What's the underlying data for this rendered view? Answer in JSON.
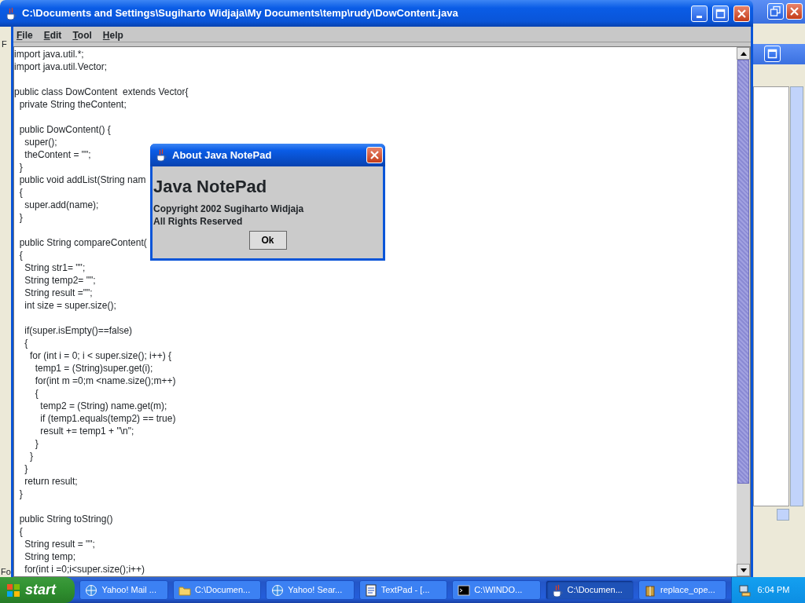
{
  "window": {
    "title": "C:\\Documents and Settings\\Sugiharto Widjaja\\My Documents\\temp\\rudy\\DowContent.java"
  },
  "menu": [
    "File",
    "Edit",
    "Tool",
    "Help"
  ],
  "editor_blocks": [
    [
      "import java.util.*;",
      "import java.util.Vector;"
    ],
    [
      "public class DowContent  extends Vector{",
      "  private String theContent;"
    ],
    [
      "  public DowContent() {",
      "    super();",
      "    theContent = \"\";",
      "  }",
      "  public void addList(String nam",
      "  {",
      "    super.add(name);",
      "  }"
    ],
    [
      "  public String compareContent(",
      "  {",
      "    String str1= \"\";",
      "    String temp2= \"\";",
      "    String result =\"\";",
      "    int size = super.size();"
    ],
    [
      "    if(super.isEmpty()==false)",
      "    {",
      "      for (int i = 0; i < super.size(); i++) {",
      "        temp1 = (String)super.get(i);",
      "        for(int m =0;m <name.size();m++)",
      "        {",
      "          temp2 = (String) name.get(m);",
      "          if (temp1.equals(temp2) == true)",
      "          result += temp1 + \"\\n\";",
      "        }",
      "      }",
      "    }",
      "    return result;",
      "  }"
    ],
    [
      "  public String toString()",
      "  {",
      "    String result = \"\";",
      "    String temp;",
      "    for(int i =0;i<super.size();i++)"
    ]
  ],
  "dialog": {
    "title": "About Java NotePad",
    "heading": "Java NotePad",
    "lines": [
      "Copyright 2002 Sugiharto Widjaja",
      "All Rights Reserved"
    ],
    "button": "Ok"
  },
  "background_window": {
    "texts": [
      "F",
      "Fo"
    ]
  },
  "taskbar": {
    "start": "start",
    "tasks": [
      {
        "label": "Yahoo! Mail ...",
        "kind": "browser",
        "selected": false
      },
      {
        "label": "C:\\Documen...",
        "kind": "folder",
        "selected": false
      },
      {
        "label": "Yahoo! Sear...",
        "kind": "browser",
        "selected": false
      },
      {
        "label": "TextPad - [...",
        "kind": "editor",
        "selected": false
      },
      {
        "label": "C:\\WINDO...",
        "kind": "console",
        "selected": false
      },
      {
        "label": "C:\\Documen...",
        "kind": "java",
        "selected": true
      },
      {
        "label": "replace_ope...",
        "kind": "archive",
        "selected": false
      }
    ],
    "clock": "6:04 PM"
  }
}
